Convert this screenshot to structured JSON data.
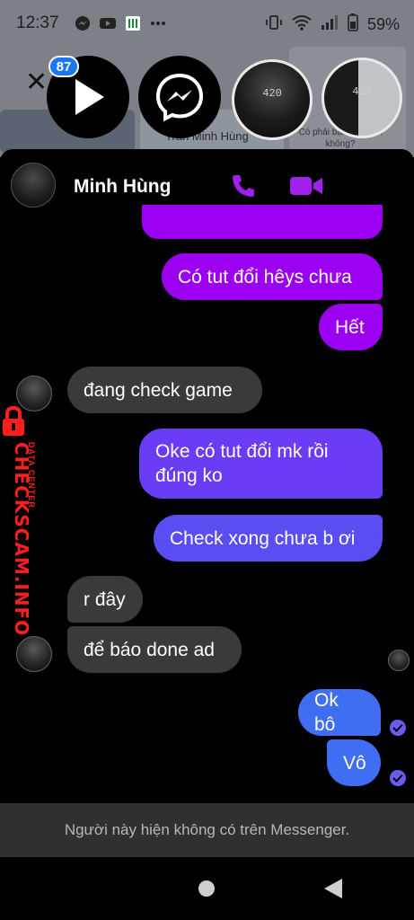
{
  "status_bar": {
    "time": "12:37",
    "battery": "59%",
    "icons": [
      "messenger-icon",
      "youtube-icon",
      "app-icon",
      "more-dots-icon",
      "vibrate-icon",
      "wifi-icon",
      "signal-icon",
      "battery-icon"
    ]
  },
  "background": {
    "name_snippet": "Trần Minh Hùng",
    "ad_text": "Có phải bạn đã nhận không?"
  },
  "chat_heads": {
    "badge_count": "87"
  },
  "header": {
    "contact_name": "Minh Hùng"
  },
  "messages": [
    {
      "direction": "outgoing",
      "text": "Có tut đổi hêys chưa"
    },
    {
      "direction": "outgoing",
      "text": "Hết"
    },
    {
      "direction": "incoming",
      "text": "đang check game"
    },
    {
      "direction": "outgoing",
      "text": "Oke có tut đổi mk rồi đúng ko"
    },
    {
      "direction": "outgoing",
      "text": "Check xong chưa b ơi"
    },
    {
      "direction": "incoming",
      "text": "r đây"
    },
    {
      "direction": "incoming",
      "text": "để báo done ad"
    },
    {
      "direction": "outgoing",
      "text": "Ok bô"
    },
    {
      "direction": "outgoing",
      "text": "Vô"
    }
  ],
  "watermark": {
    "main": "CHECKSCAM.INFO",
    "sub": "DATA CENTER"
  },
  "footer": {
    "notice": "Người này hiện không có trên Messenger."
  },
  "colors": {
    "accent_purple": "#9b00f0",
    "bubble_violet": "#6a3cf5",
    "bubble_blue": "#3f6ef3",
    "incoming_bubble": "#3a3a3c",
    "watermark_red": "#ff1e1e"
  }
}
